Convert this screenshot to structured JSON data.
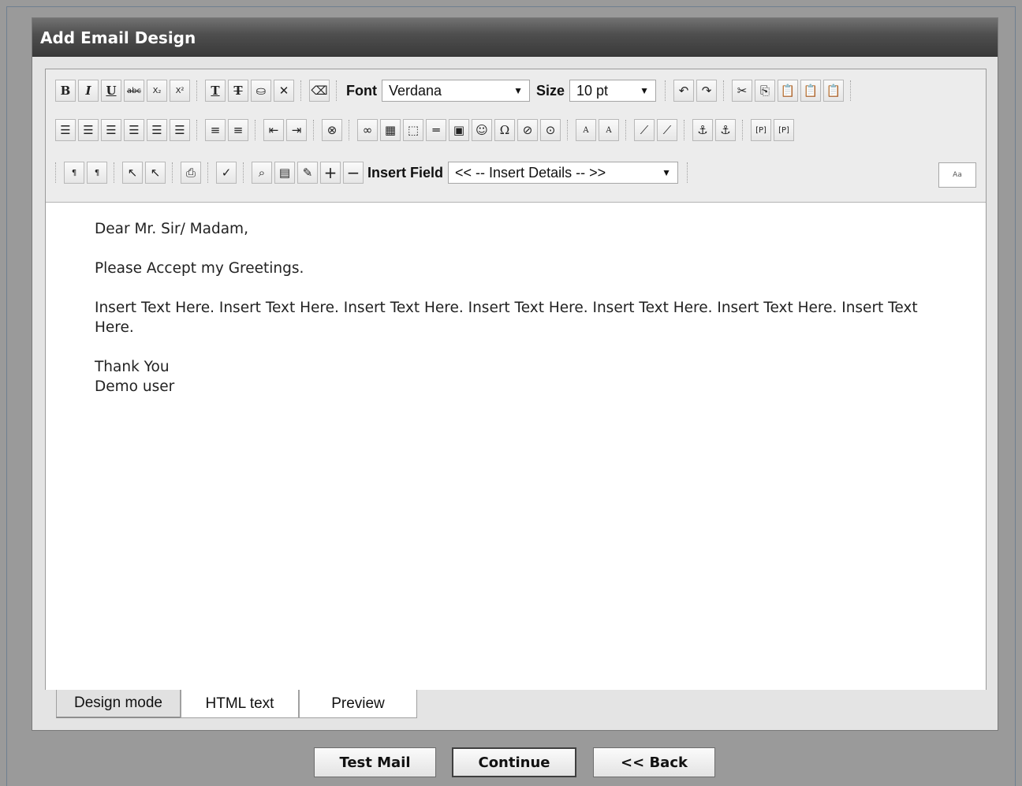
{
  "window": {
    "title": "Add Email Design"
  },
  "toolbar": {
    "row1_buttons": [
      "B",
      "I",
      "U",
      "abc",
      "X₂",
      "X²"
    ],
    "font_label": "Font",
    "font_value": "Verdana",
    "size_label": "Size",
    "size_value": "10 pt",
    "insert_field_label": "Insert Field",
    "insert_field_value": "<< -- Insert Details -- >>",
    "style_preview": "Aa"
  },
  "document": {
    "greeting": "Dear Mr. Sir/ Madam,",
    "line2": "Please Accept my Greetings.",
    "body": "Insert Text Here. Insert Text Here. Insert Text Here. Insert Text Here. Insert Text Here. Insert Text Here. Insert Text Here.",
    "closing": "Thank You",
    "signature": "Demo user"
  },
  "tabs": [
    {
      "label": "Design mode",
      "active": true
    },
    {
      "label": "HTML text",
      "active": false
    },
    {
      "label": "Preview",
      "active": false
    }
  ],
  "actions": {
    "test_mail": "Test Mail",
    "continue": "Continue",
    "back": "<< Back"
  }
}
